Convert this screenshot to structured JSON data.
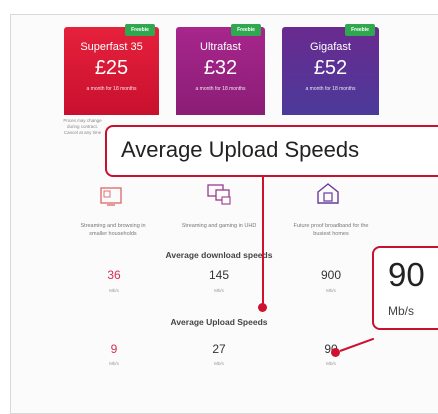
{
  "plans": [
    {
      "badge": "Freebie",
      "name": "Superfast 35",
      "price": "£25",
      "term": "a month for 18 months"
    },
    {
      "badge": "Freebie",
      "name": "Ultrafast",
      "price": "£32",
      "term": "a month for 18 months"
    },
    {
      "badge": "Freebie",
      "name": "Gigafast",
      "price": "£52",
      "term": "a month for 18 months"
    }
  ],
  "fine_print": "Prices may change during contract. Cancel at any time",
  "callout_title": "Average Upload Speeds",
  "features": [
    {
      "icon": "single-screen-icon",
      "text": "Streaming and browsing in smaller households"
    },
    {
      "icon": "multi-screen-icon",
      "text": "Streaming and gaming in UHD"
    },
    {
      "icon": "house-icon",
      "text": "Future proof broadband for the busiest homes"
    }
  ],
  "download": {
    "heading": "Average download speeds",
    "values": [
      "36",
      "145",
      "900"
    ],
    "unit": "Mb/s"
  },
  "upload": {
    "heading": "Average Upload Speeds",
    "values": [
      "9",
      "27",
      "90"
    ],
    "unit": "Mb/s"
  },
  "zoom_callout": {
    "value": "90",
    "unit": "Mb/s"
  },
  "colors": {
    "accent": "#c61230",
    "card1": "#d81a38",
    "card2": "#9a2183",
    "card3": "#5a3196",
    "badge": "#2fa84f"
  }
}
